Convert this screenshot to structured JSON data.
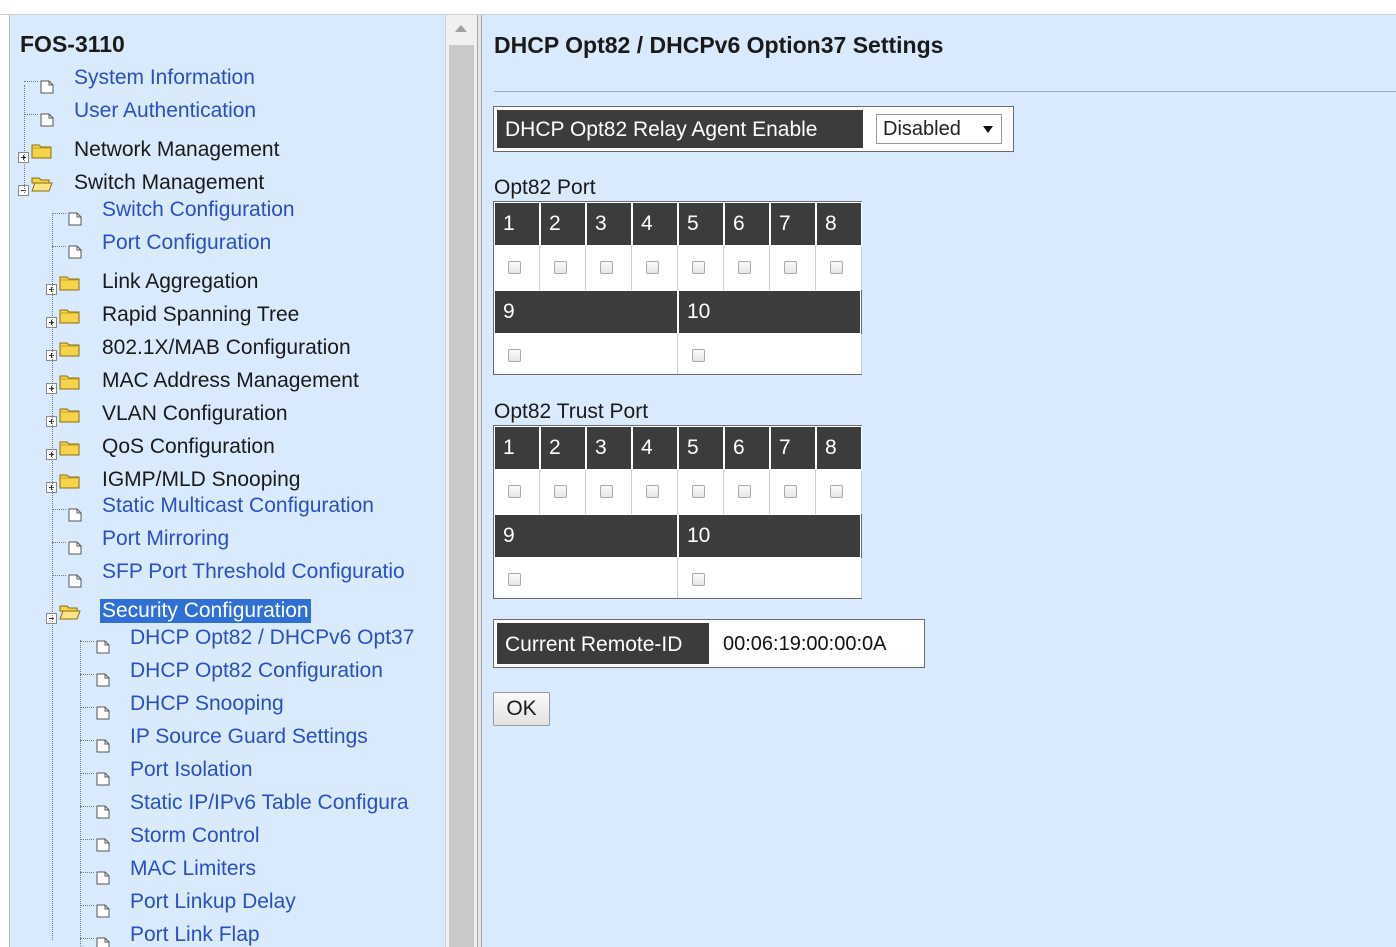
{
  "sidebar": {
    "title": "FOS-3110",
    "items": [
      {
        "label": "System Information",
        "type": "page"
      },
      {
        "label": "User Authentication",
        "type": "page"
      },
      {
        "label": "Network Management",
        "type": "folder"
      },
      {
        "label": "Switch Management",
        "type": "folder",
        "expanded": true
      },
      {
        "label": "Switch Configuration",
        "type": "page"
      },
      {
        "label": "Port Configuration",
        "type": "page"
      },
      {
        "label": "Link Aggregation",
        "type": "folder"
      },
      {
        "label": "Rapid Spanning Tree",
        "type": "folder"
      },
      {
        "label": "802.1X/MAB Configuration",
        "type": "folder"
      },
      {
        "label": "MAC Address Management",
        "type": "folder"
      },
      {
        "label": "VLAN Configuration",
        "type": "folder"
      },
      {
        "label": "QoS Configuration",
        "type": "folder"
      },
      {
        "label": "IGMP/MLD Snooping",
        "type": "folder"
      },
      {
        "label": "Static Multicast Configuration",
        "type": "page"
      },
      {
        "label": "Port Mirroring",
        "type": "page"
      },
      {
        "label": "SFP Port Threshold Configuratio",
        "type": "page"
      },
      {
        "label": "Security Configuration",
        "type": "folder",
        "expanded": true,
        "selected": true
      },
      {
        "label": "DHCP Opt82 / DHCPv6 Opt37",
        "type": "page"
      },
      {
        "label": "DHCP Opt82 Configuration",
        "type": "page"
      },
      {
        "label": "DHCP Snooping",
        "type": "page"
      },
      {
        "label": "IP Source Guard Settings",
        "type": "page"
      },
      {
        "label": "Port Isolation",
        "type": "page"
      },
      {
        "label": "Static IP/IPv6 Table Configura",
        "type": "page"
      },
      {
        "label": "Storm Control",
        "type": "page"
      },
      {
        "label": "MAC Limiters",
        "type": "page"
      },
      {
        "label": "Port Linkup Delay",
        "type": "page"
      },
      {
        "label": "Port Link Flap",
        "type": "page"
      }
    ]
  },
  "main": {
    "title": "DHCP Opt82 / DHCPv6 Option37 Settings",
    "relay_agent": {
      "label": "DHCP Opt82 Relay Agent Enable",
      "value": "Disabled"
    },
    "opt82_port": {
      "label": "Opt82 Port",
      "ports_row1": [
        "1",
        "2",
        "3",
        "4",
        "5",
        "6",
        "7",
        "8"
      ],
      "ports_row2": [
        "9",
        "10"
      ]
    },
    "opt82_trust_port": {
      "label": "Opt82 Trust Port",
      "ports_row1": [
        "1",
        "2",
        "3",
        "4",
        "5",
        "6",
        "7",
        "8"
      ],
      "ports_row2": [
        "9",
        "10"
      ]
    },
    "remote_id": {
      "label": "Current Remote-ID",
      "value": "00:06:19:00:00:0A"
    },
    "ok_label": "OK"
  },
  "colors": {
    "panel_bg": "#d8eafb",
    "header_cell": "#3c3c3c",
    "link": "#2a4fc4",
    "selection": "#2f6fd6"
  }
}
